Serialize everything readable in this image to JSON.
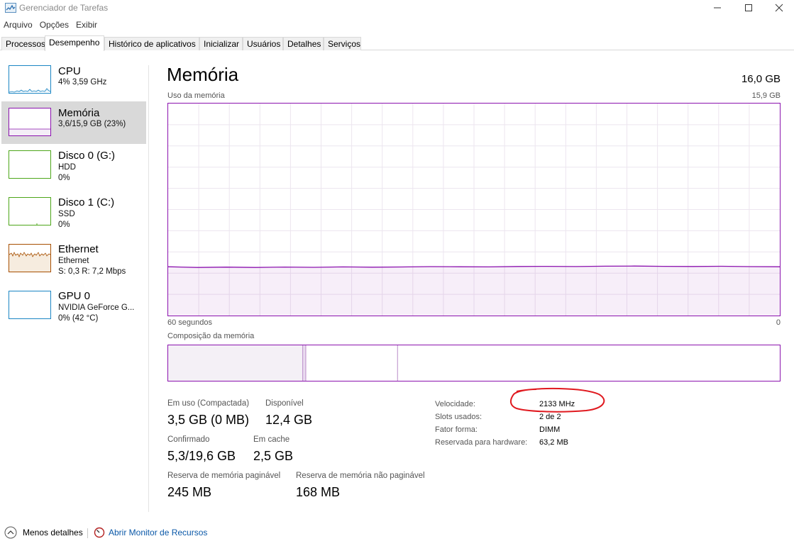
{
  "window": {
    "title": "Gerenciador de Tarefas",
    "colors": {
      "accent_memory": "#8b12ae",
      "cpu": "#1b86c4",
      "disk": "#4da619",
      "ethernet": "#a74f01",
      "annotation": "#e0191f"
    }
  },
  "menu": [
    "Arquivo",
    "Opções",
    "Exibir"
  ],
  "tabs": [
    "Processos",
    "Desempenho",
    "Histórico de aplicativos",
    "Inicializar",
    "Usuários",
    "Detalhes",
    "Serviços"
  ],
  "active_tab": "Desempenho",
  "sidebar": {
    "items": [
      {
        "name": "CPU",
        "line1": "4% 3,59 GHz",
        "line2": ""
      },
      {
        "name": "Memória",
        "line1": "3,6/15,9 GB (23%)",
        "line2": ""
      },
      {
        "name": "Disco 0 (G:)",
        "line1": "HDD",
        "line2": "0%"
      },
      {
        "name": "Disco 1 (C:)",
        "line1": "SSD",
        "line2": "0%"
      },
      {
        "name": "Ethernet",
        "line1": "Ethernet",
        "line2": "S: 0,3 R: 7,2 Mbps"
      },
      {
        "name": "GPU 0",
        "line1": "NVIDIA GeForce G...",
        "line2": "0% (42 °C)"
      }
    ]
  },
  "main": {
    "title": "Memória",
    "total": "16,0 GB",
    "usage_label": "Uso da memória",
    "usage_max": "15,9 GB",
    "time_left": "60 segundos",
    "time_right": "0",
    "usage_fraction": 0.23,
    "composition_label": "Composição da memória",
    "composition_segments": {
      "in_use_fraction": 0.22,
      "modified_fraction": 0.005,
      "standby_fraction": 0.15
    },
    "stats": {
      "in_use_label": "Em uso (Compactada)",
      "in_use_value": "3,5 GB (0 MB)",
      "available_label": "Disponível",
      "available_value": "12,4 GB",
      "committed_label": "Confirmado",
      "committed_value": "5,3/19,6 GB",
      "cached_label": "Em cache",
      "cached_value": "2,5 GB",
      "paged_label": "Reserva de memória paginável",
      "paged_value": "245 MB",
      "nonpaged_label": "Reserva de memória não paginável",
      "nonpaged_value": "168 MB"
    },
    "details": {
      "speed_label": "Velocidade:",
      "speed_value": "2133 MHz",
      "slots_label": "Slots usados:",
      "slots_value": "2 de 2",
      "form_label": "Fator forma:",
      "form_value": "DIMM",
      "reserved_label": "Reservada para hardware:",
      "reserved_value": "63,2 MB"
    }
  },
  "footer": {
    "less_details": "Menos detalhes",
    "resource_monitor": "Abrir Monitor de Recursos"
  }
}
